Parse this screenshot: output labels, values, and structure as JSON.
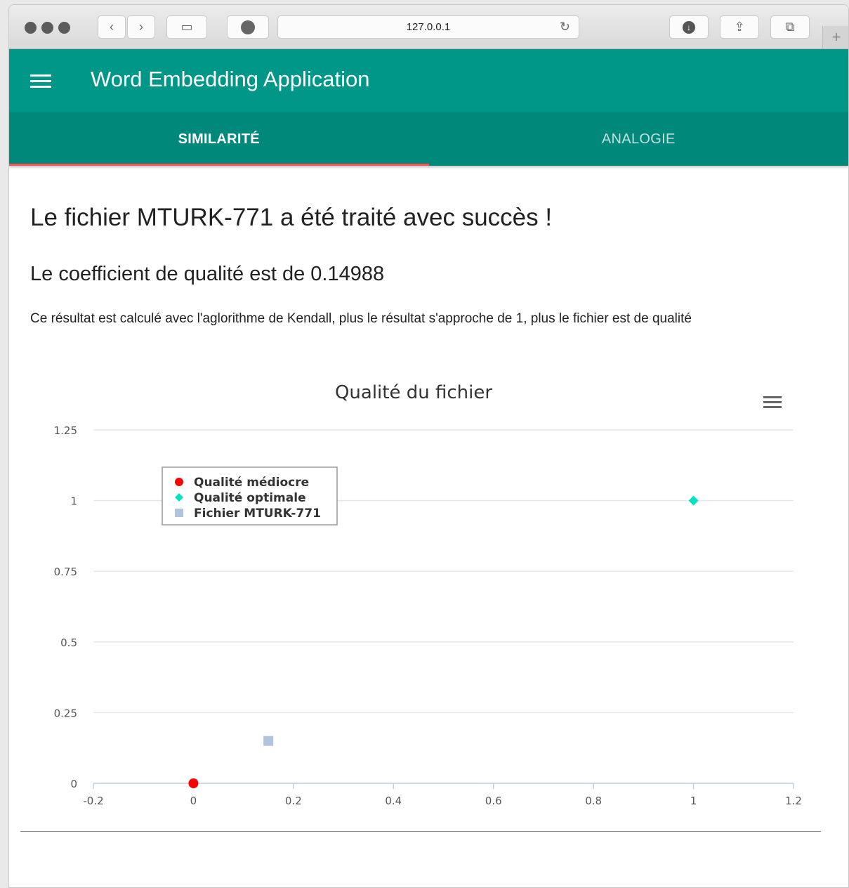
{
  "browser": {
    "url": "127.0.0.1",
    "toolbar_icons": [
      "back-icon",
      "forward-icon",
      "sidebar-icon",
      "adblock-icon",
      "reload-icon",
      "download-icon",
      "share-icon",
      "tabs-icon",
      "new-tab-icon"
    ]
  },
  "app": {
    "title": "Word Embedding Application",
    "accent": "#009688",
    "tab_color": "#00897b",
    "indicator_color": "#ff5252"
  },
  "tabs": [
    {
      "label": "SIMILARITÉ",
      "active": true
    },
    {
      "label": "ANALOGIE",
      "active": false
    }
  ],
  "main": {
    "heading": "Le fichier MTURK-771 a été traité avec succès !",
    "subheading": "Le coefficient de qualité est de 0.14988",
    "description": "Ce résultat est calculé avec l'aglorithme de Kendall, plus le résultat s'approche de 1, plus le fichier est de qualité"
  },
  "chart_data": {
    "type": "scatter",
    "title": "Qualité du fichier",
    "xlim": [
      -0.2,
      1.2
    ],
    "ylim": [
      0,
      1.25
    ],
    "xticks": [
      "-0.2",
      "0",
      "0.2",
      "0.4",
      "0.6",
      "0.8",
      "1",
      "1.2"
    ],
    "yticks": [
      "0",
      "0.25",
      "0.5",
      "0.75",
      "1",
      "1.25"
    ],
    "grid": true,
    "legend_position": "top-left",
    "series": [
      {
        "name": "Qualité médiocre",
        "marker": "circle",
        "color": "#ff0000",
        "points": [
          [
            0,
            0
          ]
        ]
      },
      {
        "name": "Qualité optimale",
        "marker": "diamond",
        "color": "#00e5c0",
        "points": [
          [
            1,
            1
          ]
        ]
      },
      {
        "name": "Fichier MTURK-771",
        "marker": "square",
        "color": "#b0c4de",
        "points": [
          [
            0.14988,
            0.14988
          ]
        ]
      }
    ]
  }
}
